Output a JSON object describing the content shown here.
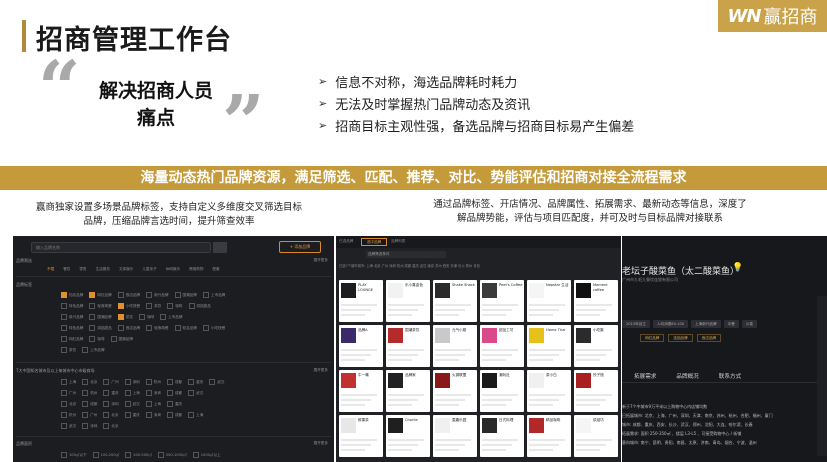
{
  "header": {
    "title": "招商管理工作台",
    "logo_mark": "WN",
    "logo_text": "赢招商"
  },
  "pain_section": {
    "quote_line1": "解决招商人员",
    "quote_line2": "痛点",
    "points": [
      "信息不对称，海选品牌耗时耗力",
      "无法及时掌握热门品牌动态及资讯",
      "招商目标主观性强，备选品牌与招商目标易产生偏差"
    ]
  },
  "banner": {
    "text": "海量动态热门品牌资源，满足筛选、匹配、推荐、对比、势能评估和招商对接全流程需求"
  },
  "descriptions": {
    "left_line1": "赢商独家设置多场景品牌标签，支持自定义多维度交叉筛选目标",
    "left_line2": "品牌，压缩品牌言选时间，提升筛查效率",
    "right_line1": "通过品牌标签、开店情况、品牌属性、拓展需求、最新动态等信息，深度了",
    "right_line2": "解品牌势能，评估与项目匹配度，并可及时与目标品牌对接联系"
  },
  "left_screenshot": {
    "search_placeholder": "输入品牌名称",
    "add_button": "+ 添加品牌",
    "section1": "品牌筛选",
    "section2": "品牌标签",
    "section3": "7大中国知名城市及以上每城市中心市级商场",
    "section4": "品牌面积",
    "more": "展开更多",
    "row_all": "不限",
    "row1": [
      "餐饮",
      "零售",
      "生活服务",
      "文体娱乐",
      "儿童亲子",
      "休闲娱乐",
      "跨境购物",
      "配套"
    ],
    "row2": [
      "知名品牌",
      "网红品牌",
      "首店品牌",
      "新兴品牌",
      "国潮品牌",
      "上市品牌"
    ],
    "row3": [
      "特色品牌",
      "轻食简餐",
      "小吃快餐",
      "茶饮",
      "咖啡",
      "烘焙甜品"
    ],
    "city_rows": [
      "上海",
      "北京",
      "广州",
      "深圳",
      "杭州",
      "成都",
      "重庆",
      "武汉"
    ],
    "area_row": [
      "100㎡以下",
      "100-200㎡",
      "200-500㎡",
      "500-1000㎡",
      "1000㎡以上"
    ]
  },
  "mid_screenshot": {
    "label": "已选品牌",
    "tab_active": "选中品牌",
    "tab_other": "品牌列表",
    "filter_value": "品牌筛选条件",
    "filter_row": "已选7个城市城市: 上海  北京  广州  深圳  杭州  成都  重庆  武汉  南京  苏州  西安  天津  长沙  郑州  青岛",
    "cards": [
      {
        "name": "PLAY LOUNGE",
        "color": "#1d1d1f"
      },
      {
        "name": "乐小喜金色",
        "color": "#f2f2f2"
      },
      {
        "name": "Shake Shack",
        "color": "#2b2b2b"
      },
      {
        "name": "Peet's Coffee",
        "color": "#3b3b3b"
      },
      {
        "name": "Nepstar 生活",
        "color": "#f5f5f5"
      },
      {
        "name": "Moment coffee",
        "color": "#111111"
      },
      {
        "name": "品牌A",
        "color": "#3a2a6a"
      },
      {
        "name": "国潮茶饮",
        "color": "#b52a2a"
      },
      {
        "name": "元气小厨",
        "color": "#c9c9c9"
      },
      {
        "name": "甜品工坊",
        "color": "#d84a8a"
      },
      {
        "name": "Home Thai",
        "color": "#e6c11a"
      },
      {
        "name": "小吃集",
        "color": "#2b2b2b"
      },
      {
        "name": "牛一嘴",
        "color": "#c23030"
      },
      {
        "name": "品牌家",
        "color": "#222222"
      },
      {
        "name": "火锅联盟",
        "color": "#8a1a1a"
      },
      {
        "name": "潮玩社",
        "color": "#1a1a1a"
      },
      {
        "name": "茶小白",
        "color": "#f0f0f0"
      },
      {
        "name": "饺子馆",
        "color": "#a82020"
      },
      {
        "name": "鲜果茶",
        "color": "#e7e7e7"
      },
      {
        "name": "Charlie",
        "color": "#1f1f1f"
      },
      {
        "name": "童趣乐园",
        "color": "#f0f0f0"
      },
      {
        "name": "日式料理",
        "color": "#2a2a2a"
      },
      {
        "name": "精品咖啡",
        "color": "#b02828"
      },
      {
        "name": "烘焙坊",
        "color": "#f5f5f5"
      }
    ]
  },
  "right_screenshot": {
    "title": "老坛子酸菜鱼（太二酸菜鱼）",
    "subtitle": "广州市九毛九餐饮连锁有限公司",
    "tags": [
      "2015年创立",
      "人均消费80-100",
      "上海新兴品牌",
      "中餐",
      "川菜"
    ],
    "tags2": [
      "网红品牌",
      "连锁品牌",
      "首店品牌"
    ],
    "tabs": [
      "拓展需求",
      "品牌概况",
      "联系方式"
    ],
    "body_line1": "新于7个中城市9万平米以上购物中心内店铺均数",
    "body_line2": "已拓展城市: 北京、上海、广州、深圳、天津、南京、苏州、杭州、合肥、福州、厦门",
    "body_line3": "城市: 成都、重庆、西安、长沙、武汉、郑州、沈阳、大连、哈尔滨、长春",
    "body_line4": "拓展需求: 面积 250-350㎡ 、楼层 L3-L5 、可接受购物中心 / 街铺",
    "body_line5": "意向城市: 南宁、昆明、贵阳、南昌、太原、济南、青岛、烟台、宁波、温州"
  },
  "colors": {
    "gold": "#c49a3a",
    "dark_bg": "#1c1d21",
    "accent_orange": "#e0912d"
  }
}
